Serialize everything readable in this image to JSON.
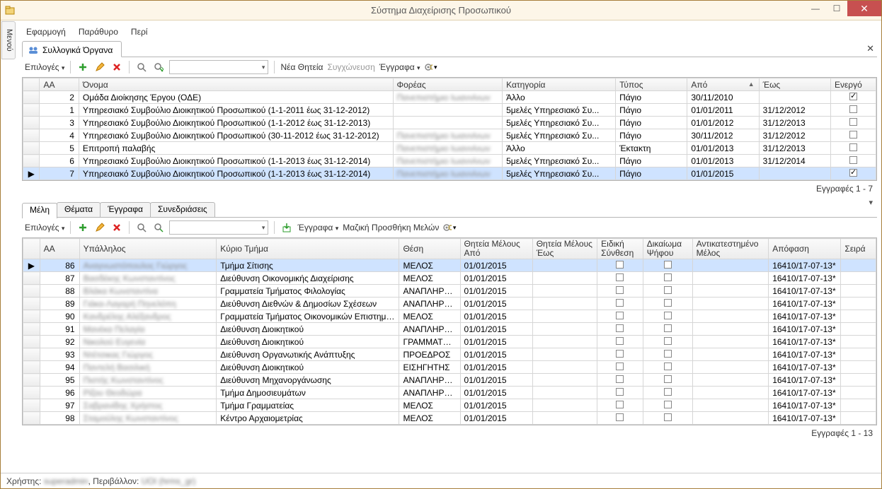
{
  "window": {
    "title": "Σύστημα Διαχείρισης Προσωπικού"
  },
  "sidetab": "Μενού",
  "menu": {
    "app": "Εφαρμογή",
    "window": "Παράθυρο",
    "about": "Περί"
  },
  "main_tab": "Συλλογικά Όργανα",
  "toolbar": {
    "options": "Επιλογές",
    "new_term": "Νέα Θητεία",
    "merge": "Συγχώνευση",
    "docs": "Έγγραφα"
  },
  "grid1": {
    "headers": {
      "aa": "ΑΑ",
      "name": "Όνομα",
      "body": "Φορέας",
      "category": "Κατηγορία",
      "type": "Τύπος",
      "from": "Από",
      "to": "Έως",
      "active": "Ενεργό"
    },
    "rows": [
      {
        "aa": 2,
        "name": "Ομάδα Διοίκησης Έργου (ΟΔΕ)",
        "body": "Πανεπιστήμιο Ιωαννίνων",
        "body_blur": true,
        "category": "Άλλο",
        "type": "Πάγιο",
        "from": "30/11/2010",
        "to": "",
        "active": true,
        "sel": false
      },
      {
        "aa": 1,
        "name": "Υπηρεσιακό Συμβούλιο Διοικητικού Προσωπικού (1-1-2011 έως 31-12-2012)",
        "body": "",
        "category": "5μελές Υπηρεσιακό Συ...",
        "type": "Πάγιο",
        "from": "01/01/2011",
        "to": "31/12/2012",
        "active": false,
        "sel": false
      },
      {
        "aa": 3,
        "name": "Υπηρεσιακό Συμβούλιο Διοικητικού Προσωπικού (1-1-2012 έως 31-12-2013)",
        "body": "",
        "category": "5μελές Υπηρεσιακό Συ...",
        "type": "Πάγιο",
        "from": "01/01/2012",
        "to": "31/12/2013",
        "active": false,
        "sel": false
      },
      {
        "aa": 4,
        "name": "Υπηρεσιακό Συμβούλιο Διοικητικού Προσωπικού (30-11-2012 έως 31-12-2012)",
        "body": "Πανεπιστήμιο Ιωαννίνων",
        "body_blur": true,
        "category": "5μελές Υπηρεσιακό Συ...",
        "type": "Πάγιο",
        "from": "30/11/2012",
        "to": "31/12/2012",
        "active": false,
        "sel": false
      },
      {
        "aa": 5,
        "name": "Επιτροπή παλαβής",
        "body": "Πανεπιστήμιο Ιωαννίνων",
        "body_blur": true,
        "category": "Άλλο",
        "type": "Έκτακτη",
        "from": "01/01/2013",
        "to": "31/12/2013",
        "active": false,
        "sel": false
      },
      {
        "aa": 6,
        "name": "Υπηρεσιακό Συμβούλιο Διοικητικού Προσωπικού (1-1-2013 έως 31-12-2014)",
        "body": "Πανεπιστήμιο Ιωαννίνων",
        "body_blur": true,
        "category": "5μελές Υπηρεσιακό Συ...",
        "type": "Πάγιο",
        "from": "01/01/2013",
        "to": "31/12/2014",
        "active": false,
        "sel": false
      },
      {
        "aa": 7,
        "name": "Υπηρεσιακό Συμβούλιο Διοικητικού Προσωπικού (1-1-2013 έως 31-12-2014)",
        "body": "Πανεπιστήμιο Ιωαννίνων",
        "body_blur": true,
        "category": "5μελές Υπηρεσιακό Συ...",
        "type": "Πάγιο",
        "from": "01/01/2015",
        "to": "",
        "active": true,
        "sel": true
      }
    ],
    "status": "Εγγραφές 1 - 7"
  },
  "lower_tabs": {
    "members": "Μέλη",
    "topics": "Θέματα",
    "docs": "Έγγραφα",
    "sessions": "Συνεδριάσεις"
  },
  "toolbar2": {
    "options": "Επιλογές",
    "docs": "Έγγραφα",
    "bulk": "Μαζική Προσθήκη Μελών"
  },
  "grid2": {
    "headers": {
      "aa": "ΑΑ",
      "emp": "Υπάλληλος",
      "dept": "Κύριο Τμήμα",
      "pos": "Θέση",
      "from": "Θητεία Μέλους Από",
      "to": "Θητεία Μέλους Έως",
      "special": "Ειδική Σύνθεση",
      "vote": "Δικαίωμα Ψήφου",
      "replaced": "Αντικατεστημένο Μέλος",
      "decision": "Απόφαση",
      "order": "Σειρά"
    },
    "rows": [
      {
        "aa": 86,
        "emp": "Αναγνωστόπουλος Γιώργος",
        "dept": "Τμήμα Σίτισης",
        "pos": "ΜΕΛΟΣ",
        "from": "01/01/2015",
        "dec": "16410/17-07-13*",
        "sel": true
      },
      {
        "aa": 87,
        "emp": "Βασδέκης Κωνσταντίνος",
        "dept": "Διεύθυνση Οικονομικής Διαχείρισης",
        "pos": "ΜΕΛΟΣ",
        "from": "01/01/2015",
        "dec": "16410/17-07-13*"
      },
      {
        "aa": 88,
        "emp": "Βλάκα Κωνσταντίνα",
        "dept": "Γραμματεία Τμήματος Φιλολογίας",
        "pos": "ΑΝΑΠΛΗΡΩ...",
        "from": "01/01/2015",
        "dec": "16410/17-07-13*"
      },
      {
        "aa": 89,
        "emp": "Γιάκα-Λαγαρή Πηνελόπη",
        "dept": "Διεύθυνση Διεθνών & Δημοσίων Σχέσεων",
        "pos": "ΑΝΑΠΛΗΡΩ...",
        "from": "01/01/2015",
        "dec": "16410/17-07-13*"
      },
      {
        "aa": 90,
        "emp": "Κανδρέλης Αλέξανδρος",
        "dept": "Γραμματεία Τμήματος Οικονομικών Επιστημών",
        "pos": "ΜΕΛΟΣ",
        "from": "01/01/2015",
        "dec": "16410/17-07-13*"
      },
      {
        "aa": 91,
        "emp": "Μανέκα Πελαγία",
        "dept": "Διεύθυνση Διοικητικού",
        "pos": "ΑΝΑΠΛΗΡΩ...",
        "from": "01/01/2015",
        "dec": "16410/17-07-13*"
      },
      {
        "aa": 92,
        "emp": "Νικολού Ευγενία",
        "dept": "Διεύθυνση Διοικητικού",
        "pos": "ΓΡΑΜΜΑΤΕΑΣ",
        "from": "01/01/2015",
        "dec": "16410/17-07-13*"
      },
      {
        "aa": 93,
        "emp": "Ντέτσικας Γιώργος",
        "dept": "Διεύθυνση Οργανωτικής Ανάπτυξης",
        "pos": "ΠΡΟΕΔΡΟΣ",
        "from": "01/01/2015",
        "dec": "16410/17-07-13*"
      },
      {
        "aa": 94,
        "emp": "Παντελή Βασιλική",
        "dept": "Διεύθυνση Διοικητικού",
        "pos": "ΕΙΣΗΓΗΤΗΣ",
        "from": "01/01/2015",
        "dec": "16410/17-07-13*"
      },
      {
        "aa": 95,
        "emp": "Πιστής Κωνσταντίνος",
        "dept": "Διεύθυνση Μηχανοργάνωσης",
        "pos": "ΑΝΑΠΛΗΡΩ...",
        "from": "01/01/2015",
        "dec": "16410/17-07-13*"
      },
      {
        "aa": 96,
        "emp": "Ρίζου Θεοδώρα",
        "dept": "Τμήμα Δημοσιευμάτων",
        "pos": "ΑΝΑΠΛΗΡΩ...",
        "from": "01/01/2015",
        "dec": "16410/17-07-13*"
      },
      {
        "aa": 97,
        "emp": "Σαβρανίδης Χρήστος",
        "dept": "Τμήμα Γραμματείας",
        "pos": "ΜΕΛΟΣ",
        "from": "01/01/2015",
        "dec": "16410/17-07-13*"
      },
      {
        "aa": 98,
        "emp": "Σταμούλης Κωνσταντίνος",
        "dept": "Κέντρο Αρχαιομετρίας",
        "pos": "ΜΕΛΟΣ",
        "from": "01/01/2015",
        "dec": "16410/17-07-13*"
      }
    ],
    "status": "Εγγραφές 1 - 13"
  },
  "footer": {
    "user_label": "Χρήστης:",
    "user": "superadmin",
    "env_label": "Περιβάλλον:",
    "env": "UOI (hrms_gr)"
  }
}
